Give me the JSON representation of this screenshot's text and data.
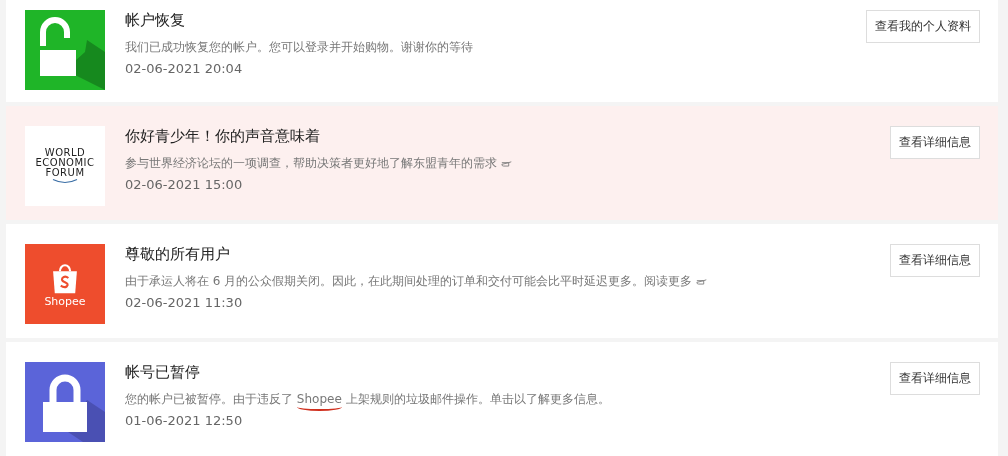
{
  "notifications": [
    {
      "kind": "unlock",
      "highlighted": false,
      "title": "帐户恢复",
      "message": [
        {
          "text": "我们已成功恢复您的帐户。您可以登录并开始购物。谢谢你的等待",
          "marked": false
        }
      ],
      "hand_icon": false,
      "time": "02-06-2021 20:04",
      "button": "查看我的个人资料"
    },
    {
      "kind": "wef",
      "highlighted": true,
      "logo_lines": [
        "WORLD",
        "ECONOMIC",
        "FORUM"
      ],
      "title": "你好青少年！你的声音意味着",
      "message": [
        {
          "text": "参与世界经济论坛的一项调查，帮助决策者更好地了解东盟青年的需求",
          "marked": false
        }
      ],
      "hand_icon": true,
      "time": "02-06-2021 15:00",
      "button": "查看详细信息"
    },
    {
      "kind": "shopee",
      "highlighted": false,
      "logo_lines": [
        "Shopee"
      ],
      "title": "尊敬的所有用户",
      "message": [
        {
          "text": "由于承运人将在 6 月的公众假期关闭。因此，在此期间处理的订单和交付可能会比平时延迟更多。阅读更多",
          "marked": false
        }
      ],
      "hand_icon": true,
      "time": "02-06-2021 11:30",
      "button": "查看详细信息"
    },
    {
      "kind": "lock",
      "highlighted": false,
      "title": "帐号已暂停",
      "message": [
        {
          "text": "您的帐户已被暂停。由于违反了 ",
          "marked": false
        },
        {
          "text": "Shopee",
          "marked": true
        },
        {
          "text": " 上架规则的垃圾邮件操作。单击以了解更多信息。",
          "marked": false
        }
      ],
      "hand_icon": false,
      "time": "01-06-2021 12:50",
      "button": "查看详细信息"
    }
  ]
}
